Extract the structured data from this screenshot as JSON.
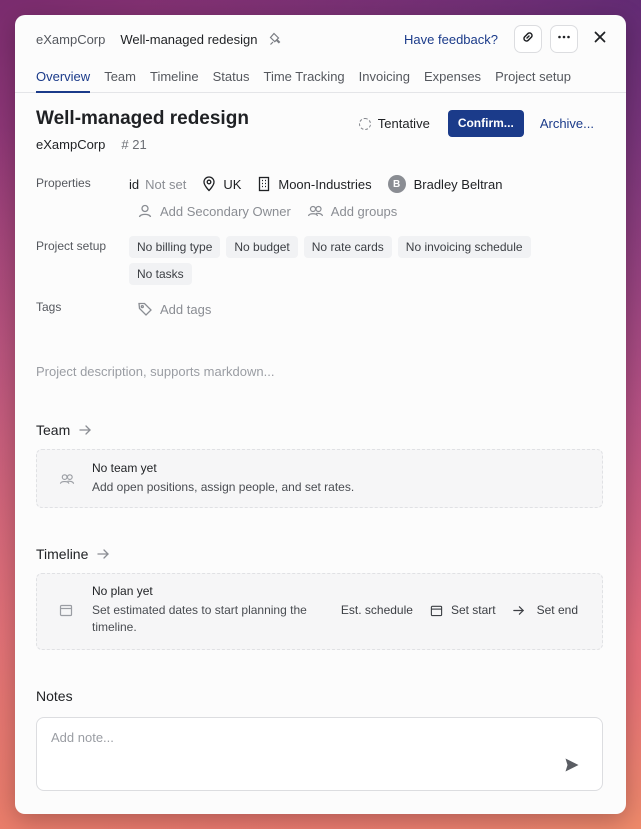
{
  "header": {
    "org": "eXampCorp",
    "project": "Well-managed redesign",
    "feedback_label": "Have feedback?"
  },
  "tabs": [
    {
      "label": "Overview",
      "active": true
    },
    {
      "label": "Team"
    },
    {
      "label": "Timeline"
    },
    {
      "label": "Status"
    },
    {
      "label": "Time Tracking"
    },
    {
      "label": "Invoicing"
    },
    {
      "label": "Expenses"
    },
    {
      "label": "Project setup"
    }
  ],
  "project": {
    "title": "Well-managed redesign",
    "org": "eXampCorp",
    "number": "# 21",
    "status": "Tentative",
    "confirm_label": "Confirm...",
    "archive_label": "Archive..."
  },
  "properties": {
    "label": "Properties",
    "id_key": "id",
    "id_value": "Not set",
    "location": "UK",
    "client": "Moon-Industries",
    "owner_initial": "B",
    "owner": "Bradley Beltran",
    "add_secondary_owner": "Add Secondary Owner",
    "add_groups": "Add groups"
  },
  "project_setup": {
    "label": "Project setup",
    "chips": [
      "No billing type",
      "No budget",
      "No rate cards",
      "No invoicing schedule",
      "No tasks"
    ]
  },
  "tags": {
    "label": "Tags",
    "add_label": "Add tags"
  },
  "description_placeholder": "Project description, supports markdown...",
  "team": {
    "title": "Team",
    "empty_title": "No team yet",
    "empty_text": "Add open positions, assign people, and set rates."
  },
  "timeline": {
    "title": "Timeline",
    "empty_title": "No plan yet",
    "empty_text_1": "Set estimated dates to start planning the",
    "empty_text_2": "timeline.",
    "est_schedule": "Est. schedule",
    "set_start": "Set start",
    "set_end": "Set end"
  },
  "notes": {
    "title": "Notes",
    "placeholder": "Add note..."
  },
  "colors": {
    "accent": "#1b3b8a",
    "text": "#1f2124",
    "muted": "#8a8d93"
  }
}
